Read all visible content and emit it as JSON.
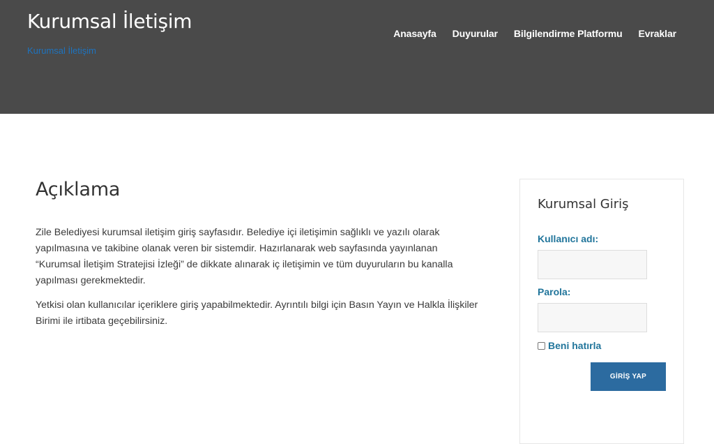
{
  "header": {
    "site_title": "Kurumsal İletişim",
    "tagline": "Kurumsal İletişim",
    "nav": [
      "Anasayfa",
      "Duyurular",
      "Bilgilendirme Platformu",
      "Evraklar"
    ],
    "colors": {
      "background": "#4a4a4a",
      "tagline": "#1e73be"
    }
  },
  "main": {
    "heading": "Açıklama",
    "paragraphs": [
      "Zile Belediyesi kurumsal iletişim giriş sayfasıdır. Belediye içi iletişimin sağlıklı ve yazılı olarak yapılmasına ve takibine olanak veren bir sistemdir. Hazırlanarak web sayfasında yayınlanan “Kurumsal İletişim Stratejisi İzleği” de dikkate alınarak iç iletişimin ve tüm duyuruların bu kanalla yapılması gerekmektedir.",
      "Yetkisi olan kullanıcılar içeriklere giriş yapabilmektedir. Ayrıntılı bilgi için Basın Yayın ve Halkla İlişkiler Birimi ile irtibata geçebilirsiniz."
    ]
  },
  "login": {
    "title": "Kurumsal Giriş",
    "username_label": "Kullanıcı adı:",
    "username_value": "",
    "password_label": "Parola:",
    "password_value": "",
    "remember_label": "Beni hatırla",
    "remember_checked": false,
    "submit_label": "GİRİŞ YAP",
    "colors": {
      "label": "#21759b",
      "button": "#2c6ba0"
    }
  }
}
